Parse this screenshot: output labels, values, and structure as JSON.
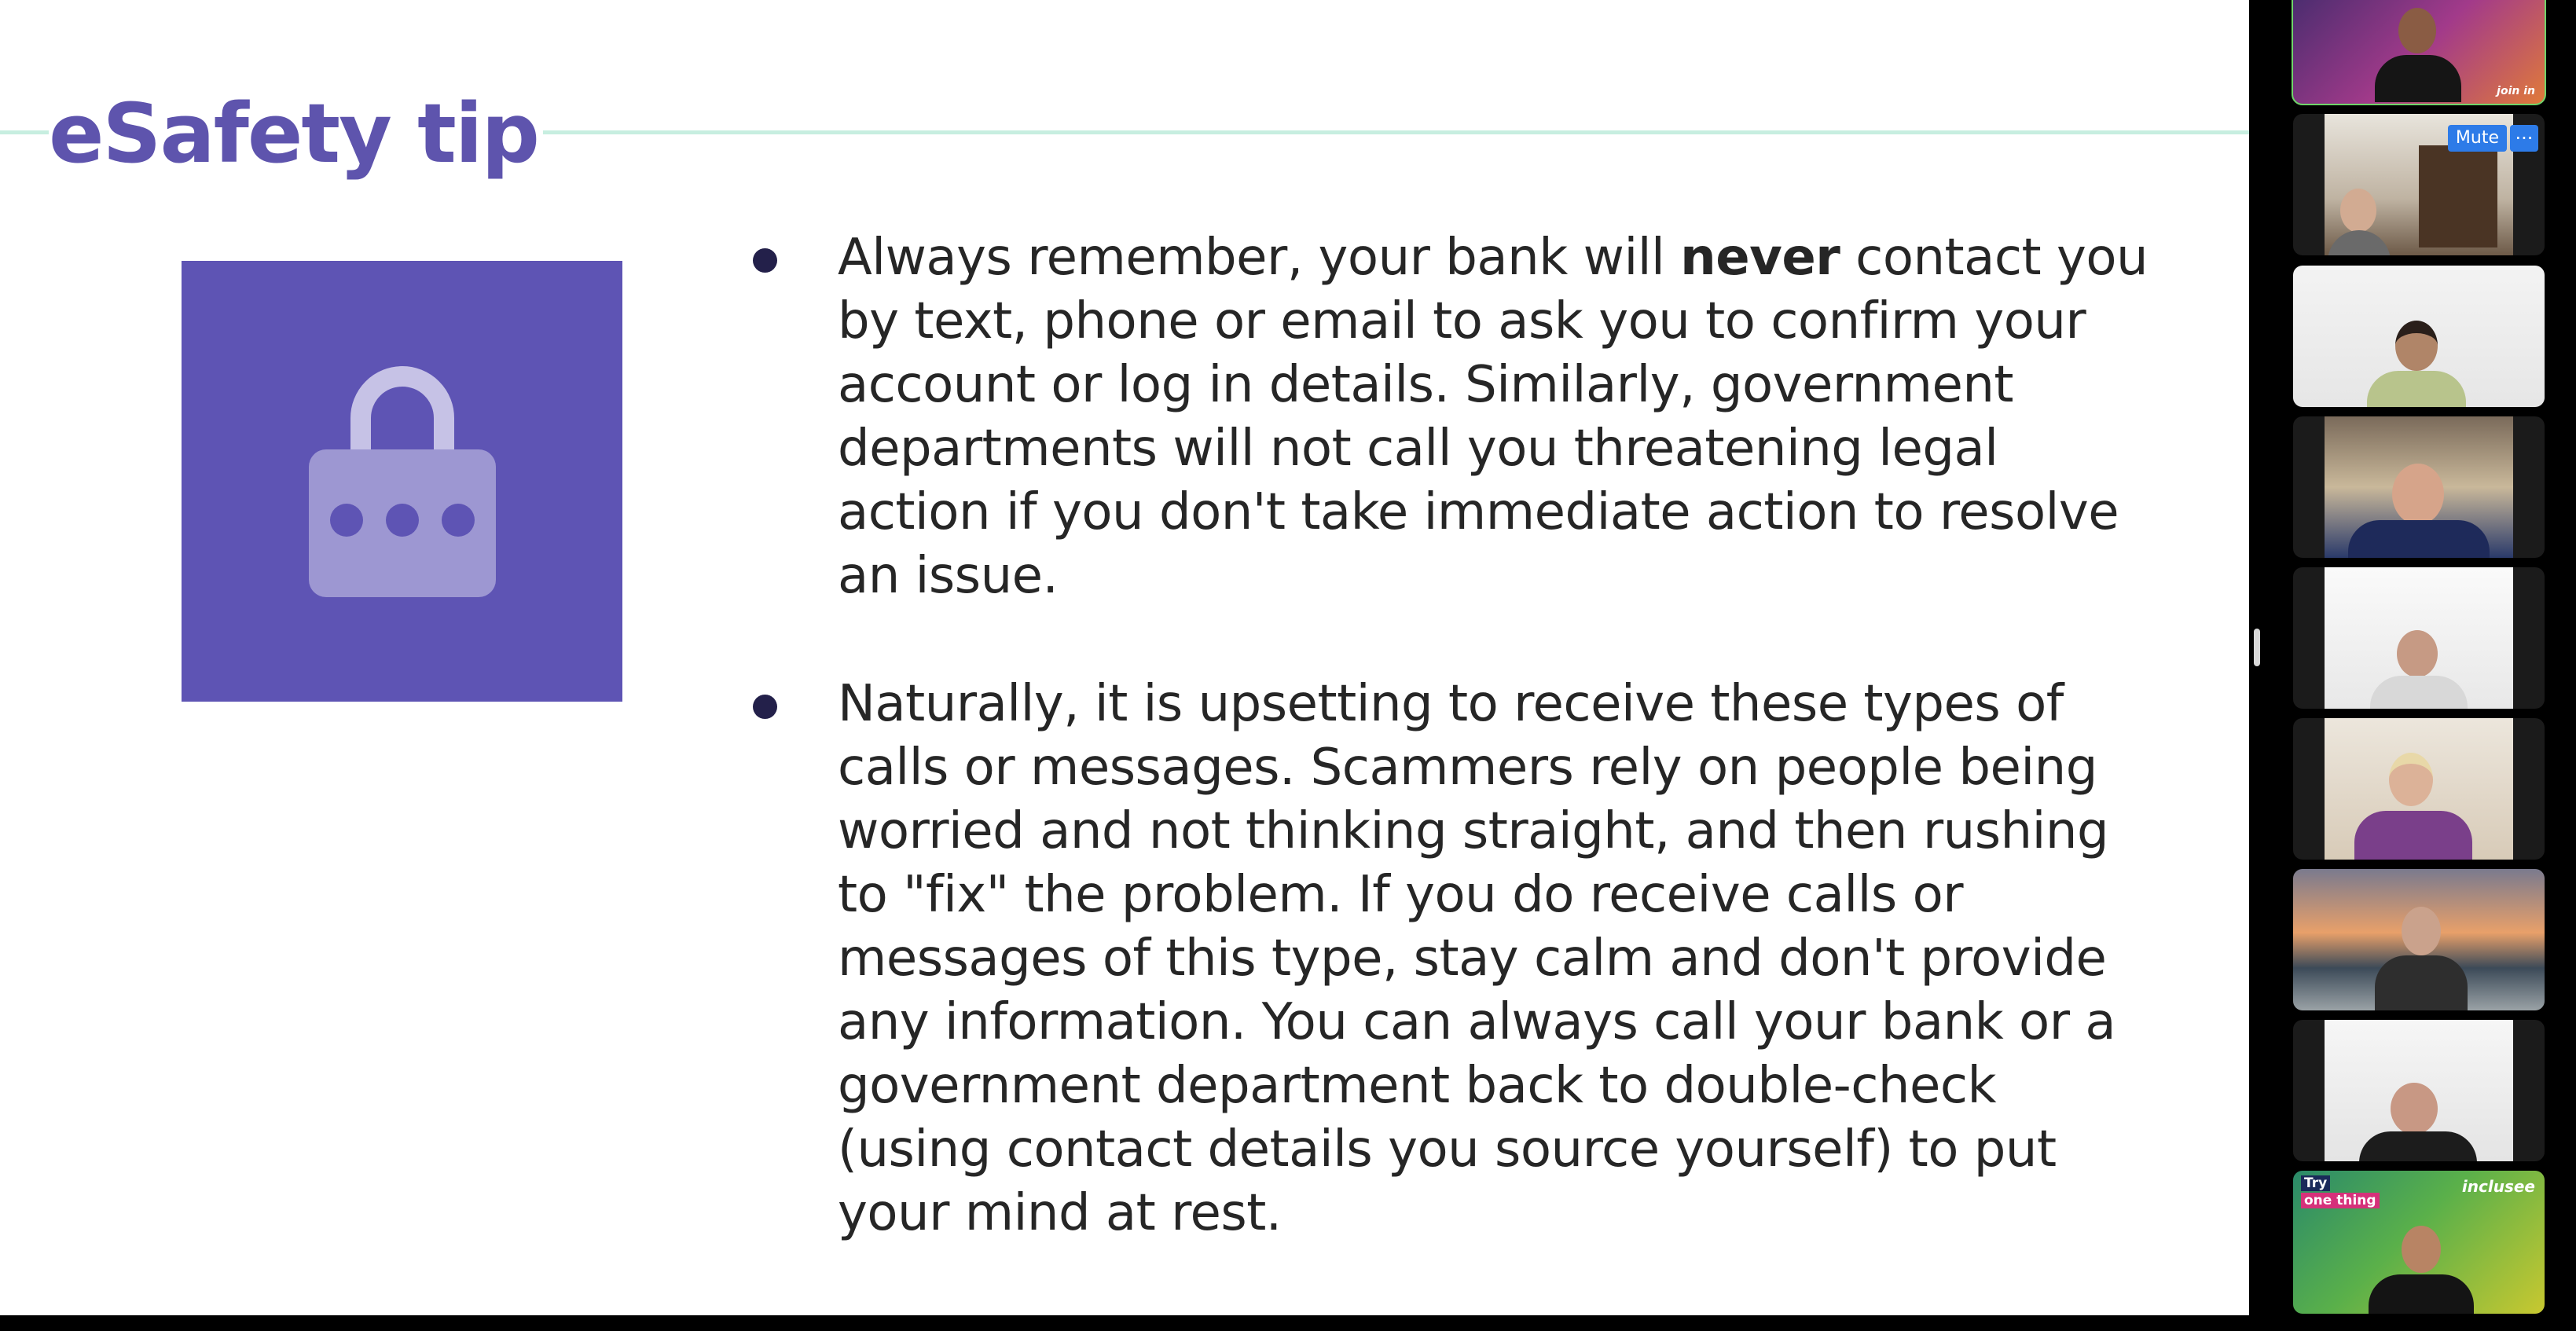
{
  "slide": {
    "title": "eSafety tip",
    "icon": "lock-icon",
    "accent_color": "#5e54b4",
    "rule_color": "#c7eee0",
    "bullets": [
      {
        "before": "Always remember, your bank will ",
        "bold": "never",
        "after": " contact you by text, phone or email to ask you to confirm your account or log in details. Similarly, government departments will not call you threatening legal action if you don't take immediate action to resolve an issue."
      },
      {
        "before": "Naturally, it is upsetting to receive these types of calls or messages. Scammers rely on people being worried and not thinking straight, and then rushing to \"fix\" the problem. If you do receive calls or messages of this type, stay calm and don't provide any information. You can always call your bank or a government department back to double-check (using contact details you source yourself) to put your mind at rest."
      }
    ]
  },
  "participants": {
    "active_speaker_color": "#6fd46a",
    "tiles": [
      {
        "label": "participant-1",
        "brand_text": "join in",
        "active": true
      },
      {
        "label": "participant-2",
        "mute_label": "Mute",
        "more_label": "···"
      },
      {
        "label": "participant-3"
      },
      {
        "label": "participant-4"
      },
      {
        "label": "participant-5"
      },
      {
        "label": "participant-6"
      },
      {
        "label": "participant-7"
      },
      {
        "label": "participant-8"
      },
      {
        "label": "participant-9",
        "promo_try": "Try",
        "promo_one": "one thing",
        "promo_brand": "inclusee"
      }
    ]
  }
}
